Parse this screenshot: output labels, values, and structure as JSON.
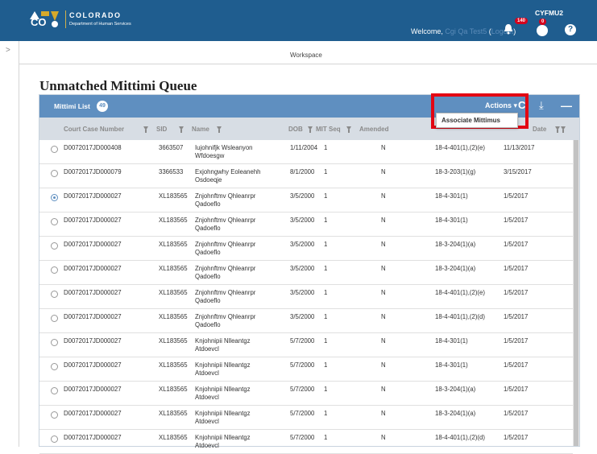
{
  "header": {
    "brand_title": "COLORADO",
    "brand_subtitle": "Department of Human Services",
    "logo_initials": "CO",
    "welcome_prefix": "Welcome,",
    "user_name": "Cgi Qa Test5",
    "logout_label": "Logout",
    "notification_count": "140",
    "role_code": "CYFMU2",
    "alert_count": "0",
    "help_glyph": "?"
  },
  "workspace": {
    "label": "Workspace"
  },
  "page": {
    "title": "Unmatched Mittimi Queue"
  },
  "panel": {
    "title": "Mittimi List",
    "count": "49",
    "actions_label": "Actions ▾",
    "refresh_glyph": "C",
    "download_glyph": "⤓",
    "collapse_glyph": "—",
    "dropdown_item": "Associate Mittimus"
  },
  "columns": {
    "court_case_number": "Court Case Number",
    "sid": "SID",
    "name": "Name",
    "dob": "DOB",
    "mit_seq": "MIT Seq",
    "amended": "Amended",
    "date": "Date"
  },
  "rows": [
    {
      "case": "D0072017JD000408",
      "sid": "3663507",
      "name1": "Iujohnifjk Wsleanyon",
      "name2": "Wfdoesgw",
      "dob": "1/11/2004",
      "seq": "1",
      "amended": "N",
      "charge": "18-4-401(1),(2)(e)",
      "date": "11/13/2017",
      "checked": false
    },
    {
      "case": "D0072017JD000079",
      "sid": "3366533",
      "name1": "Exjohngwhy Eoleanehh",
      "name2": "Osdoeqje",
      "dob": "8/1/2000",
      "seq": "1",
      "amended": "N",
      "charge": "18-3-203(1)(g)",
      "date": "3/15/2017",
      "checked": false
    },
    {
      "case": "D0072017JD000027",
      "sid": "XL183565",
      "name1": "Znjohnftmv Qhleanrpr",
      "name2": "Qadoeflo",
      "dob": "3/5/2000",
      "seq": "1",
      "amended": "N",
      "charge": "18-4-301(1)",
      "date": "1/5/2017",
      "checked": true
    },
    {
      "case": "D0072017JD000027",
      "sid": "XL183565",
      "name1": "Znjohnftmv Qhleanrpr",
      "name2": "Qadoeflo",
      "dob": "3/5/2000",
      "seq": "1",
      "amended": "N",
      "charge": "18-4-301(1)",
      "date": "1/5/2017",
      "checked": false
    },
    {
      "case": "D0072017JD000027",
      "sid": "XL183565",
      "name1": "Znjohnftmv Qhleanrpr",
      "name2": "Qadoeflo",
      "dob": "3/5/2000",
      "seq": "1",
      "amended": "N",
      "charge": "18-3-204(1)(a)",
      "date": "1/5/2017",
      "checked": false
    },
    {
      "case": "D0072017JD000027",
      "sid": "XL183565",
      "name1": "Znjohnftmv Qhleanrpr",
      "name2": "Qadoeflo",
      "dob": "3/5/2000",
      "seq": "1",
      "amended": "N",
      "charge": "18-3-204(1)(a)",
      "date": "1/5/2017",
      "checked": false
    },
    {
      "case": "D0072017JD000027",
      "sid": "XL183565",
      "name1": "Znjohnftmv Qhleanrpr",
      "name2": "Qadoeflo",
      "dob": "3/5/2000",
      "seq": "1",
      "amended": "N",
      "charge": "18-4-401(1),(2)(e)",
      "date": "1/5/2017",
      "checked": false
    },
    {
      "case": "D0072017JD000027",
      "sid": "XL183565",
      "name1": "Znjohnftmv Qhleanrpr",
      "name2": "Qadoeflo",
      "dob": "3/5/2000",
      "seq": "1",
      "amended": "N",
      "charge": "18-4-401(1),(2)(d)",
      "date": "1/5/2017",
      "checked": false
    },
    {
      "case": "D0072017JD000027",
      "sid": "XL183565",
      "name1": "Knjohnipii Nlleantgz",
      "name2": "Atdoevcl",
      "dob": "5/7/2000",
      "seq": "1",
      "amended": "N",
      "charge": "18-4-301(1)",
      "date": "1/5/2017",
      "checked": false
    },
    {
      "case": "D0072017JD000027",
      "sid": "XL183565",
      "name1": "Knjohnipii Nlleantgz",
      "name2": "Atdoevcl",
      "dob": "5/7/2000",
      "seq": "1",
      "amended": "N",
      "charge": "18-4-301(1)",
      "date": "1/5/2017",
      "checked": false
    },
    {
      "case": "D0072017JD000027",
      "sid": "XL183565",
      "name1": "Knjohnipii Nlleantgz",
      "name2": "Atdoevcl",
      "dob": "5/7/2000",
      "seq": "1",
      "amended": "N",
      "charge": "18-3-204(1)(a)",
      "date": "1/5/2017",
      "checked": false
    },
    {
      "case": "D0072017JD000027",
      "sid": "XL183565",
      "name1": "Knjohnipii Nlleantgz",
      "name2": "Atdoevcl",
      "dob": "5/7/2000",
      "seq": "1",
      "amended": "N",
      "charge": "18-3-204(1)(a)",
      "date": "1/5/2017",
      "checked": false
    },
    {
      "case": "D0072017JD000027",
      "sid": "XL183565",
      "name1": "Knjohnipii Nlleantgz",
      "name2": "Atdoevcl",
      "dob": "5/7/2000",
      "seq": "1",
      "amended": "N",
      "charge": "18-4-401(1),(2)(d)",
      "date": "1/5/2017",
      "checked": false
    }
  ],
  "colors": {
    "header_bg": "#1f5d8f",
    "panel_head_bg": "#5f8fc0",
    "highlight_border": "#e30613",
    "badge_red": "#d6001c"
  }
}
